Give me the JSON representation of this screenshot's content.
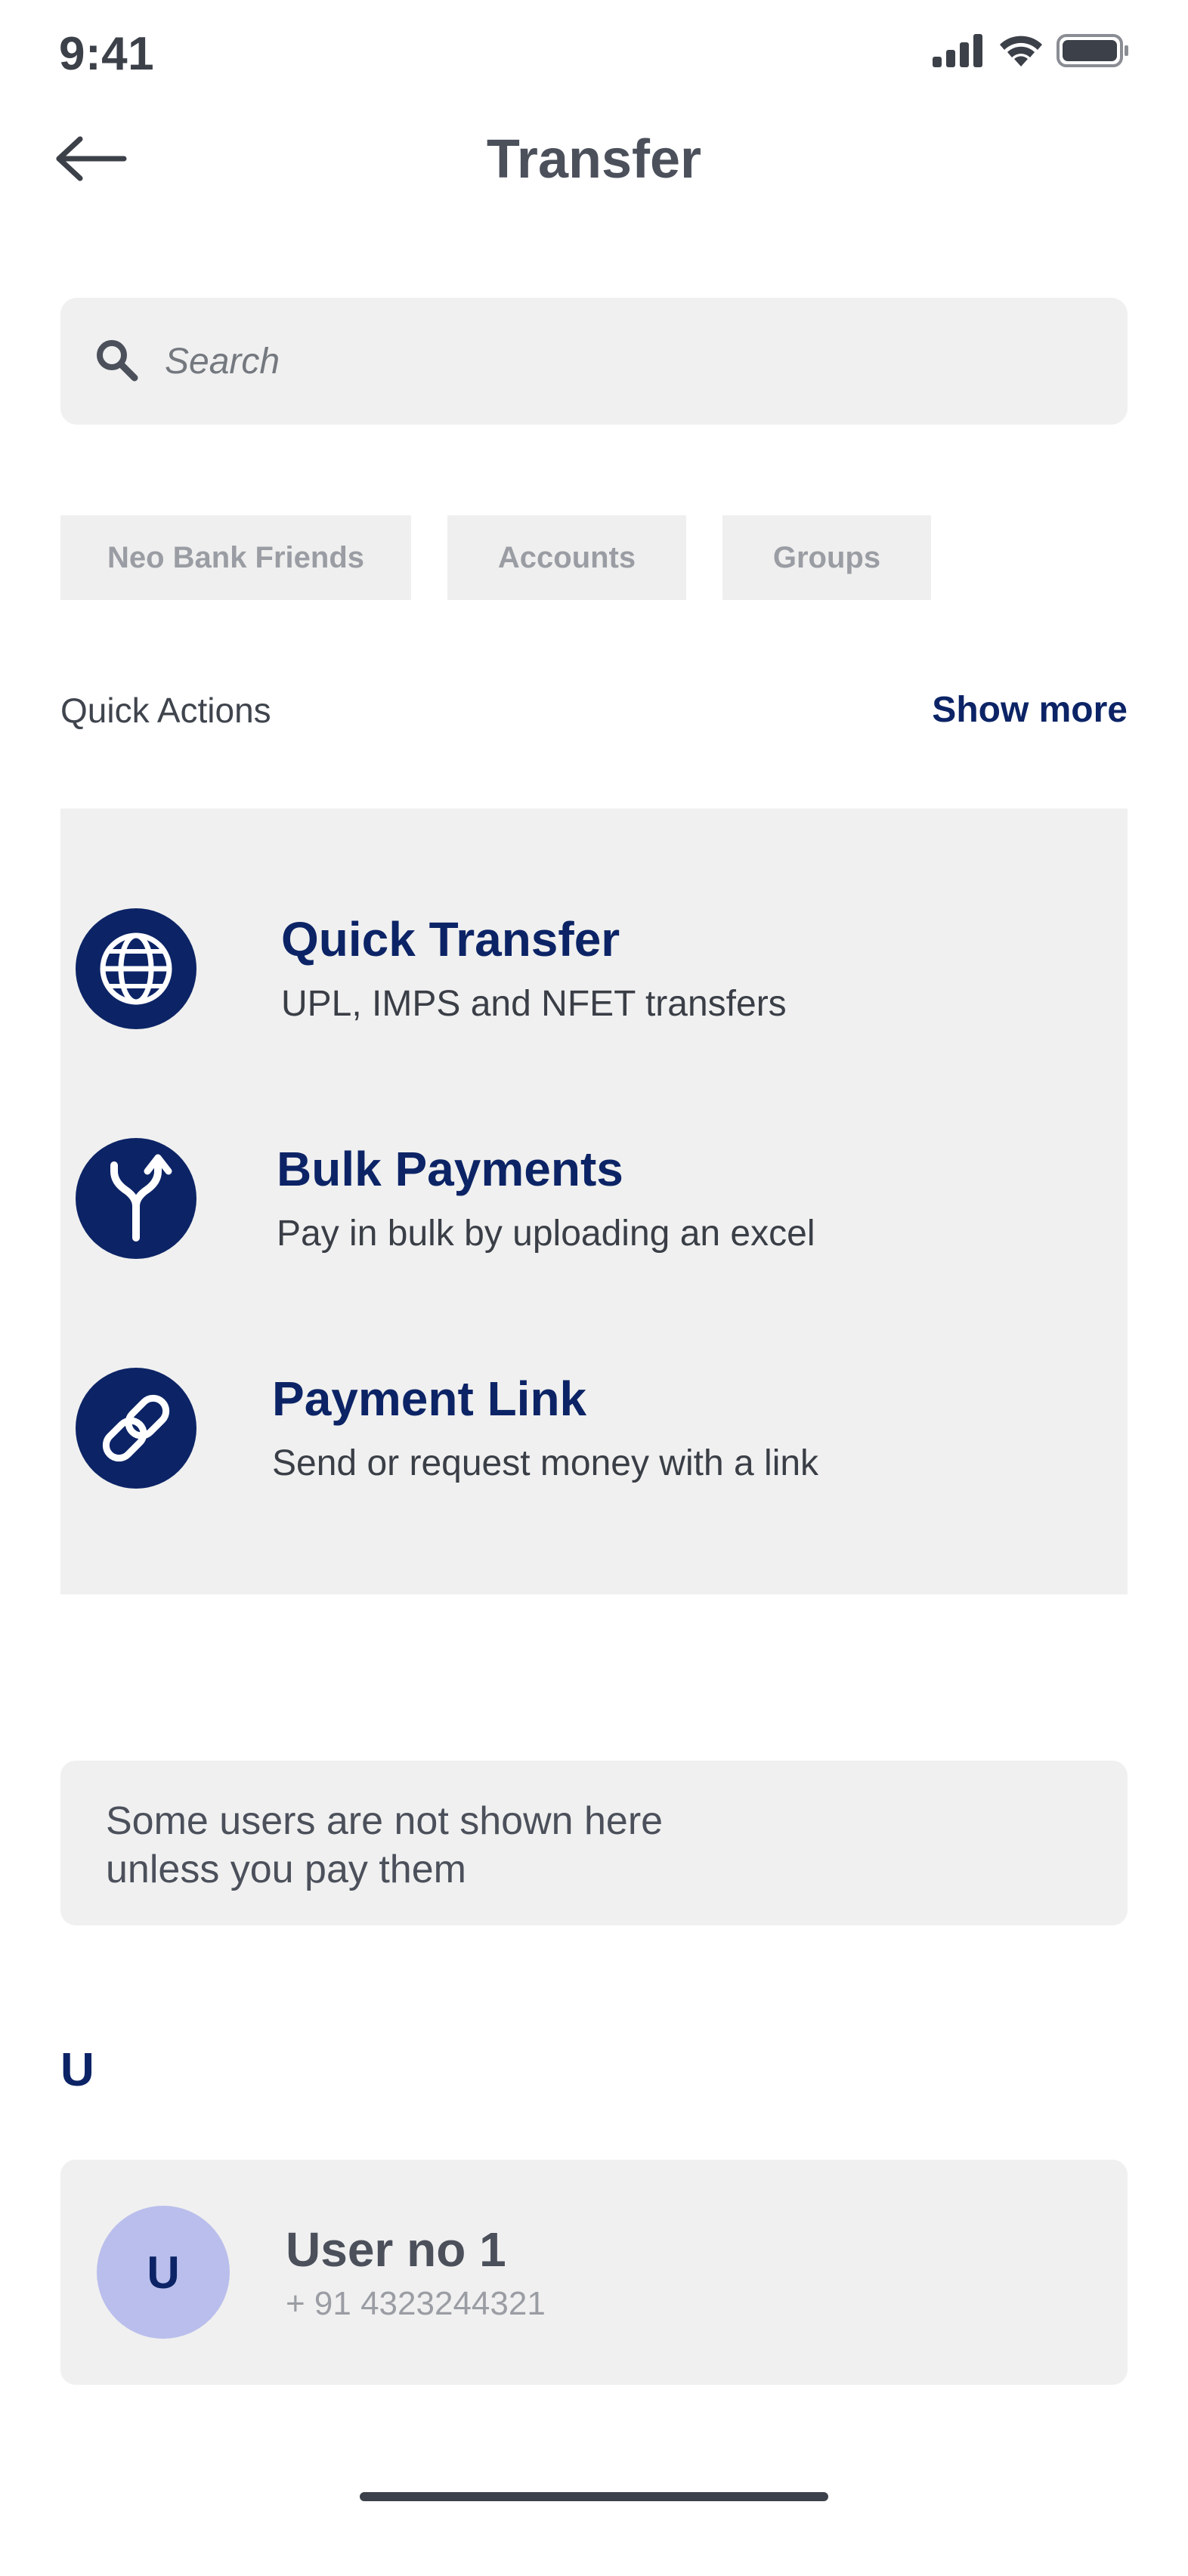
{
  "status_bar": {
    "time": "9:41",
    "icons": [
      "signal-icon",
      "wifi-icon",
      "battery-icon"
    ]
  },
  "header": {
    "title": "Transfer",
    "back_icon": "arrow-left-icon"
  },
  "search": {
    "placeholder": "Search",
    "icon": "search-icon"
  },
  "chips": [
    {
      "label": "Neo Bank Friends"
    },
    {
      "label": "Accounts"
    },
    {
      "label": "Groups"
    }
  ],
  "quick_actions": {
    "title": "Quick Actions",
    "show_more": "Show more",
    "items": [
      {
        "title": "Quick Transfer",
        "subtitle": "UPL, IMPS and NFET transfers",
        "icon": "globe-icon"
      },
      {
        "title": "Bulk Payments",
        "subtitle": "Pay in bulk by uploading an excel",
        "icon": "split-arrow-icon"
      },
      {
        "title": "Payment Link",
        "subtitle": "Send or request money with a link",
        "icon": "link-icon"
      }
    ]
  },
  "notice": {
    "line1": "Some users are not shown here",
    "line2": "unless you pay them"
  },
  "contacts": {
    "section_letter": "U",
    "users": [
      {
        "initial": "U",
        "name": "User no 1",
        "phone": "+ 91 4323244321"
      }
    ]
  },
  "colors": {
    "brand": "#0c2466",
    "card_bg": "#f0f0f0",
    "avatar_bg": "#babeec",
    "text_dark": "#4b505b",
    "text_muted": "#9a9da3"
  }
}
